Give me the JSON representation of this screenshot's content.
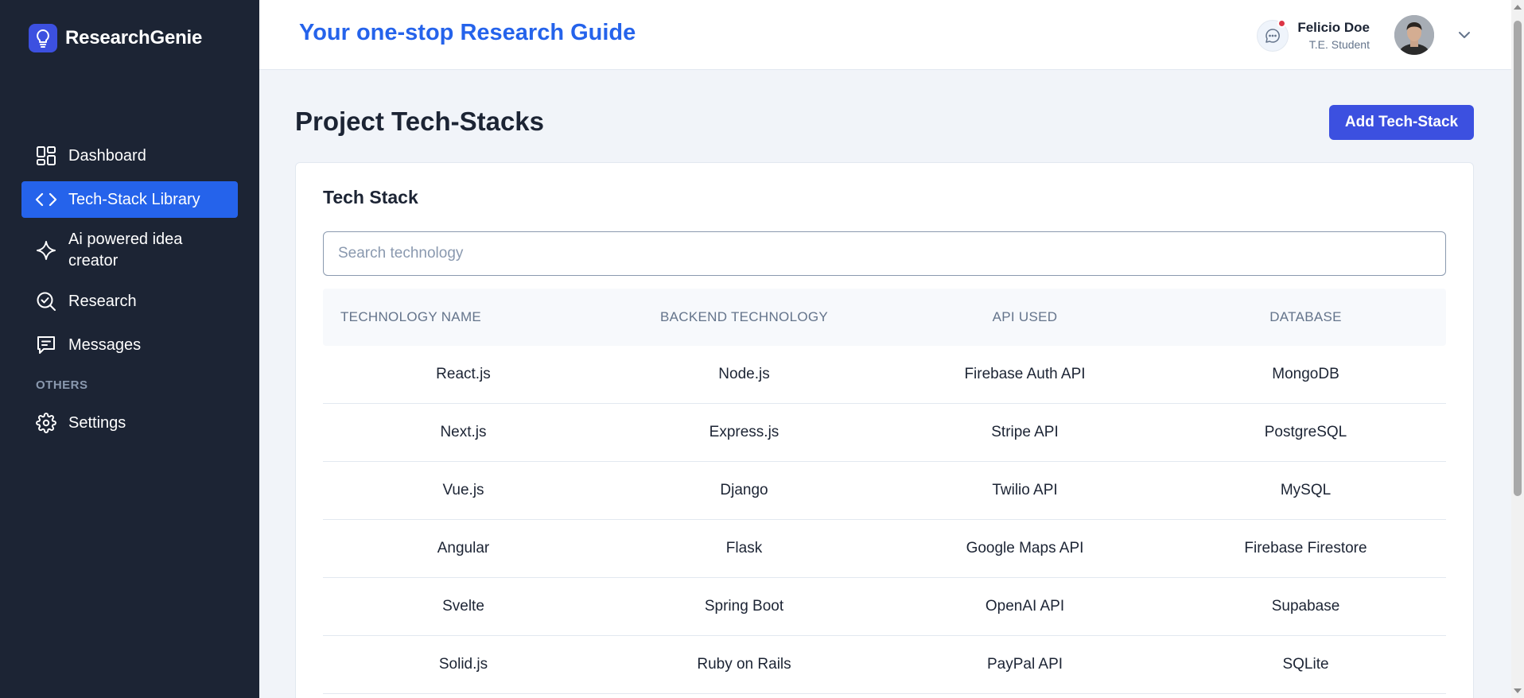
{
  "brand": {
    "name": "ResearchGenie"
  },
  "sidebar": {
    "items": [
      {
        "label": "Dashboard",
        "icon": "dashboard-grid-icon",
        "active": false
      },
      {
        "label": "Tech-Stack Library",
        "icon": "code-brackets-icon",
        "active": true
      },
      {
        "label": "Ai powered idea creator",
        "icon": "sparkle-icon",
        "active": false
      },
      {
        "label": "Research",
        "icon": "search-check-icon",
        "active": false
      },
      {
        "label": "Messages",
        "icon": "message-icon",
        "active": false
      }
    ],
    "section_label": "OTHERS",
    "others": [
      {
        "label": "Settings",
        "icon": "gear-icon"
      }
    ]
  },
  "header": {
    "title": "Your one-stop Research Guide",
    "user": {
      "name": "Felicio Doe",
      "role": "T.E. Student"
    },
    "has_notification": true
  },
  "main": {
    "page_title": "Project Tech-Stacks",
    "add_button_label": "Add Tech-Stack",
    "card_title": "Tech Stack",
    "search_placeholder": "Search technology",
    "table": {
      "columns": [
        "TECHNOLOGY NAME",
        "BACKEND TECHNOLOGY",
        "API USED",
        "DATABASE"
      ],
      "rows": [
        [
          "React.js",
          "Node.js",
          "Firebase Auth API",
          "MongoDB"
        ],
        [
          "Next.js",
          "Express.js",
          "Stripe API",
          "PostgreSQL"
        ],
        [
          "Vue.js",
          "Django",
          "Twilio API",
          "MySQL"
        ],
        [
          "Angular",
          "Flask",
          "Google Maps API",
          "Firebase Firestore"
        ],
        [
          "Svelte",
          "Spring Boot",
          "OpenAI API",
          "Supabase"
        ],
        [
          "Solid.js",
          "Ruby on Rails",
          "PayPal API",
          "SQLite"
        ]
      ]
    }
  },
  "colors": {
    "sidebar_bg": "#1c2434",
    "accent": "#2563eb",
    "button": "#3c50e0",
    "notification": "#dc3545"
  }
}
